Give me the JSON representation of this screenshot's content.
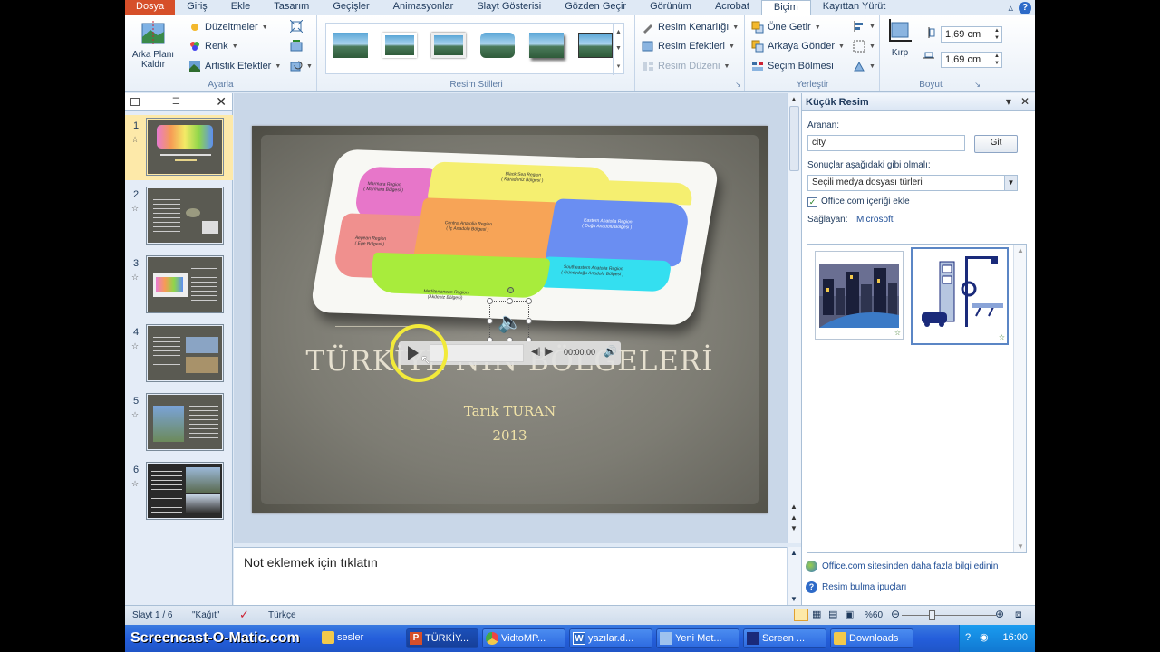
{
  "tabs": [
    "Dosya",
    "Giriş",
    "Ekle",
    "Tasarım",
    "Geçişler",
    "Animasyonlar",
    "Slayt Gösterisi",
    "Gözden Geçir",
    "Görünüm",
    "Acrobat",
    "Biçim",
    "Kayıttan Yürüt"
  ],
  "ribbon": {
    "remove_bg": "Arka Planı Kaldır",
    "corrections": "Düzeltmeler",
    "color": "Renk",
    "artistic": "Artistik Efektler",
    "group_adjust": "Ayarla",
    "group_styles": "Resim Stilleri",
    "border": "Resim Kenarlığı",
    "effects": "Resim Efektleri",
    "layout": "Resim Düzeni",
    "bring_forward": "Öne Getir",
    "send_backward": "Arkaya Gönder",
    "selection_pane": "Seçim Bölmesi",
    "group_arrange": "Yerleştir",
    "crop": "Kırp",
    "height": "1,69 cm",
    "width": "1,69 cm",
    "group_size": "Boyut"
  },
  "thumbs": [
    "1",
    "2",
    "3",
    "4",
    "5",
    "6"
  ],
  "slide": {
    "title": "TÜRKİYE'NİN BÖLGELERİ",
    "author": "Tarık TURAN",
    "year": "2013",
    "media_time": "00:00.00",
    "map_labels": {
      "black_sea": "Black Sea Region",
      "black_sea_tr": "( Karadeniz Bölgesi )",
      "marmara": "Marmara Region",
      "marmara_tr": "( Marmara Bölgesi )",
      "central": "Central Anatolia Region",
      "central_tr": "( İç Anadolu Bölgesi )",
      "eastern": "Eastern Anatolia Region",
      "eastern_tr": "( Doğu Anadolu Bölgesi )",
      "aegean": "Aegean Region",
      "aegean_tr": "( Ege Bölgesi )",
      "southeastern": "Southeastern Anatolia Region",
      "southeastern_tr": "( Güneydoğu Anadolu Bölgesi )",
      "mediterranean": "Mediterranean Region",
      "mediterranean_tr": "(Akdeniz Bölgesi)"
    }
  },
  "notes_placeholder": "Not eklemek için tıklatın",
  "clip_pane": {
    "title": "Küçük Resim",
    "search_label": "Aranan:",
    "search_value": "city",
    "go": "Git",
    "results_label": "Sonuçlar aşağıdaki gibi olmalı:",
    "results_value": "Seçili medya dosyası türleri",
    "include_office": "Office.com içeriği ekle",
    "provider_label": "Sağlayan:",
    "provider": "Microsoft",
    "link_more": "Office.com sitesinden daha fazla bilgi edinin",
    "link_tips": "Resim bulma ipuçları"
  },
  "status": {
    "slide": "Slayt 1 / 6",
    "theme": "\"Kağıt\"",
    "language": "Türkçe",
    "zoom": "%60"
  },
  "taskbar": {
    "brand": "Screencast-O-Matic.com",
    "items": [
      "sesler",
      "TÜRKİY...",
      "VidtoMP...",
      "yazılar.d...",
      "Yeni Met...",
      "Screen ...",
      "Downloads"
    ],
    "clock": "16:00"
  },
  "colors": {
    "file_tab": "#d64f2a",
    "ribbon_bg": "#dfe9f5",
    "taskbar": "#245edb",
    "highlight_ring": "#f2ea3a"
  }
}
